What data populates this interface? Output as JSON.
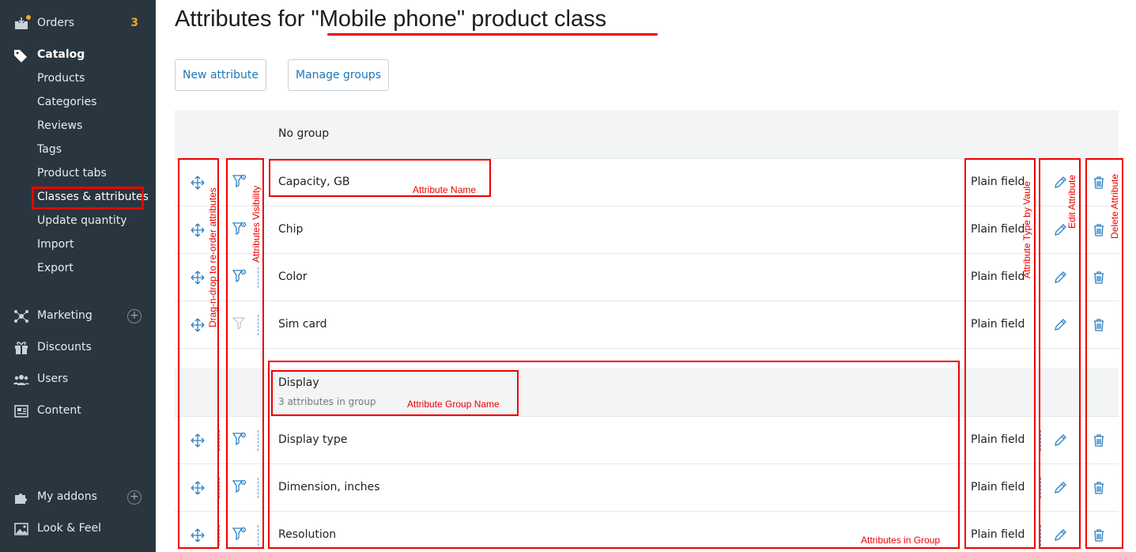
{
  "sidebar": {
    "orders": {
      "label": "Orders",
      "badge": "3"
    },
    "catalog": {
      "label": "Catalog"
    },
    "catalog_items": [
      "Products",
      "Categories",
      "Reviews",
      "Tags",
      "Product tabs",
      "Classes & attributes",
      "Update quantity",
      "Import",
      "Export"
    ],
    "marketing": {
      "label": "Marketing"
    },
    "discounts": {
      "label": "Discounts"
    },
    "users": {
      "label": "Users"
    },
    "content": {
      "label": "Content"
    },
    "addons": {
      "label": "My addons"
    },
    "look": {
      "label": "Look & Feel"
    }
  },
  "page": {
    "title": "Attributes for \"Mobile phone\" product class",
    "new_attribute_label": "New attribute",
    "manage_groups_label": "Manage groups"
  },
  "groups": [
    {
      "name": "No group",
      "count_text": ""
    },
    {
      "name": "Display",
      "count_text": "3 attributes in group"
    }
  ],
  "attributes": [
    {
      "name": "Capacity, GB",
      "type": "Plain field",
      "visible": true
    },
    {
      "name": "Chip",
      "type": "Plain field",
      "visible": true
    },
    {
      "name": "Color",
      "type": "Plain field",
      "visible": true
    },
    {
      "name": "Sim card",
      "type": "Plain field",
      "visible": false
    },
    {
      "name": "Display type",
      "type": "Plain field",
      "visible": true
    },
    {
      "name": "Dimension, inches",
      "type": "Plain field",
      "visible": true
    },
    {
      "name": "Resolution",
      "type": "Plain field",
      "visible": true
    }
  ],
  "annotations": {
    "drag": "Drag-n-drop to re-order attributes",
    "visibility": "Attributes Visibility",
    "attr_name": "Attribute Name",
    "group_name": "Attribute Group Name",
    "in_group": "Attributes in Group",
    "type": "Attribute Type by Vaule",
    "edit": "Edit Attribute",
    "delete": "Delete Attribute"
  },
  "colors": {
    "sidebar_bg": "#29363f",
    "accent": "#1a78b8",
    "badge": "#f6a623",
    "annotation": "#e00000"
  }
}
